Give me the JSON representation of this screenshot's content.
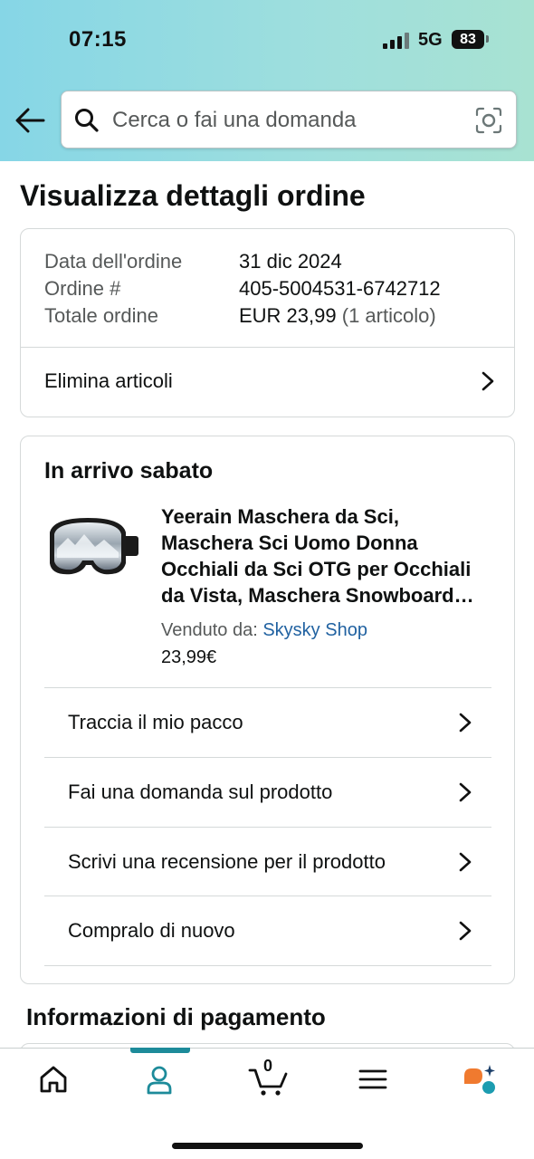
{
  "status_bar": {
    "time": "07:15",
    "network": "5G",
    "battery": "83"
  },
  "search": {
    "placeholder": "Cerca o fai una domanda"
  },
  "page_title": "Visualizza dettagli ordine",
  "order_summary": {
    "rows": [
      {
        "label": "Data dell'ordine",
        "value": "31 dic 2024"
      },
      {
        "label": "Ordine #",
        "value": "405-5004531-6742712"
      },
      {
        "label": "Totale ordine",
        "value": "EUR 23,99",
        "extra": "(1 articolo)"
      }
    ],
    "delete_items_label": "Elimina articoli"
  },
  "shipment": {
    "arrival": "In arrivo sabato",
    "product_title": "Yeerain Maschera da Sci, Maschera Sci Uomo Donna Occhiali da Sci OTG per Occhiali da Vista, Maschera Snowboard…",
    "sold_by_label": "Venduto da:",
    "seller": "Skysky Shop",
    "price": "23,99€",
    "actions": [
      "Traccia il mio pacco",
      "Fai una domanda sul prodotto",
      "Scrivi una recensione per il prodotto",
      "Compralo di nuovo"
    ]
  },
  "payment_section_title": "Informazioni di pagamento",
  "tabbar": {
    "active_tab": "account",
    "cart_count": "0",
    "accent_color": "#1d8b9a",
    "tabs": [
      {
        "name": "home",
        "icon": "home-icon"
      },
      {
        "name": "account",
        "icon": "account-icon"
      },
      {
        "name": "cart",
        "icon": "cart-icon"
      },
      {
        "name": "menu",
        "icon": "menu-icon"
      },
      {
        "name": "rufus",
        "icon": "assistant-icon"
      }
    ]
  },
  "colors": {
    "link": "#2162a1",
    "header_start": "#86d6e6",
    "header_end": "#a8e2d2"
  }
}
